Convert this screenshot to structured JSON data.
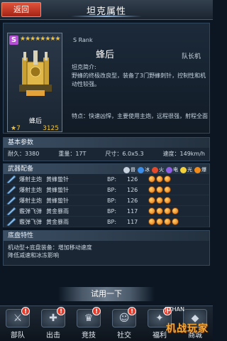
{
  "header": {
    "back_label": "返回",
    "title": "坦克属性"
  },
  "hero": {
    "rank_badge": "S",
    "stars": "★★★★★★★★",
    "card_name": "蜂后",
    "card_level": "★7",
    "card_cost": "3125",
    "rank_label": "S Rank",
    "tank_name": "蜂后",
    "role": "队长机",
    "intro_title": "坦克简介:",
    "intro_text": "野蜂的终极改良型，装备了3门野蜂刺针，控制性和机动性较强。",
    "feature": "特点：快速凶悍，主要使用主炮，远程很强，射程全面"
  },
  "basic": {
    "title": "基本参数",
    "stats": [
      {
        "label": "耐久：",
        "value": "3380"
      },
      {
        "label": "重量：",
        "value": "17T"
      },
      {
        "label": "尺寸：",
        "value": "6.0x5.3"
      },
      {
        "label": "速度：",
        "value": "149km/h"
      }
    ]
  },
  "weapons": {
    "title": "武器配备",
    "legend": [
      {
        "label": "普",
        "color": "#c7d2df"
      },
      {
        "label": "冰",
        "color": "#3d8ee8"
      },
      {
        "label": "火",
        "color": "#e44a2c"
      },
      {
        "label": "电",
        "color": "#8e5fe0"
      },
      {
        "label": "光",
        "color": "#f3d13c"
      },
      {
        "label": "爆",
        "color": "#ef8a1c"
      }
    ],
    "bp_label": "BP:",
    "rows": [
      {
        "type": "爆射主炮",
        "name": "黄蜂蛰针",
        "bp": "126",
        "orbs": 3
      },
      {
        "type": "爆射主炮",
        "name": "黄蜂蛰针",
        "bp": "126",
        "orbs": 3
      },
      {
        "type": "爆射主炮",
        "name": "黄蜂蛰针",
        "bp": "126",
        "orbs": 3
      },
      {
        "type": "霰弹飞弹",
        "name": "黄金暴雨",
        "bp": "117",
        "orbs": 4
      },
      {
        "type": "霰弹飞弹",
        "name": "黄金暴雨",
        "bp": "117",
        "orbs": 4
      }
    ]
  },
  "chassis": {
    "title": "底盘特性",
    "lines": [
      "机动型+底盘装备：增加移动速度",
      "降低减速和冰冻影响"
    ]
  },
  "trial_label": "试用一下",
  "nav": [
    {
      "label": "部队",
      "icon": "⚔",
      "alert": "!"
    },
    {
      "label": "出击",
      "icon": "✚",
      "alert": "!"
    },
    {
      "label": "竞技",
      "icon": "♛",
      "alert": "!"
    },
    {
      "label": "社交",
      "icon": "☺",
      "alert": "!"
    },
    {
      "label": "福利",
      "icon": "✦",
      "alert": "!"
    },
    {
      "label": "商城",
      "icon": "◆",
      "alert": ""
    }
  ],
  "watermark": {
    "text": "机战玩家",
    "site": "JIZHAN"
  }
}
